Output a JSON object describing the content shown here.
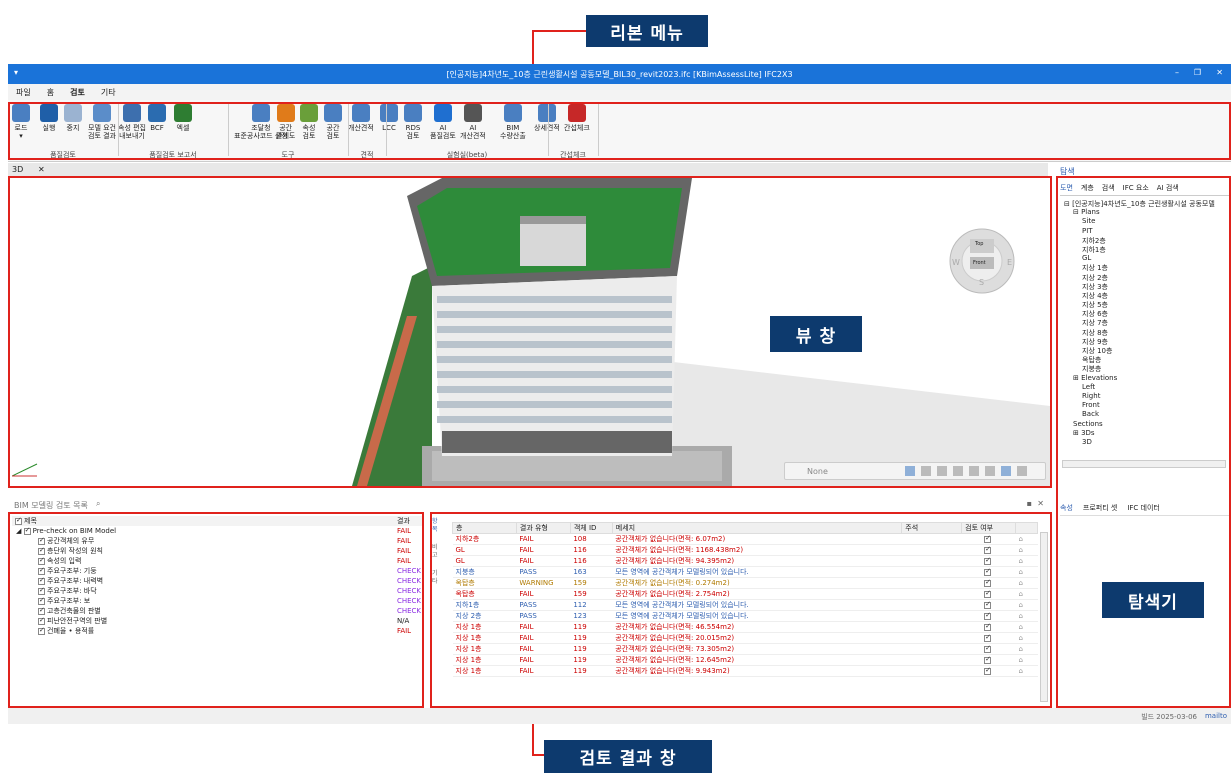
{
  "callouts": {
    "ribbon": "리본 메뉴",
    "view": "뷰 창",
    "navigator": "탐색기",
    "results": "검토 결과 창"
  },
  "window": {
    "title": "[인공지능]4차년도_10층 근린생활시설 공동모델_BIL30_revit2023.ifc [KBimAssessLite] IFC2X3",
    "minimize": "–",
    "restore": "❐",
    "close": "✕",
    "quick_access": "▾"
  },
  "menu": [
    "파일",
    "홈",
    "검토",
    "기타"
  ],
  "ribbon": {
    "buttons": [
      {
        "label": "로드\n▾",
        "icon": "load-icon",
        "color": "#4a7fc1"
      },
      {
        "label": "실행",
        "icon": "play-icon",
        "color": "#1f5fa8"
      },
      {
        "label": "중지",
        "icon": "stop-icon",
        "color": "#9bb3d1"
      },
      {
        "label": "모델 요건\n검토 결과",
        "icon": "report-icon",
        "color": "#5b8dc9"
      },
      {
        "label": "속성 편집\n내보내기",
        "icon": "export-icon",
        "color": "#3d6fae"
      },
      {
        "label": "BCF",
        "icon": "bcf-icon",
        "color": "#2b6cb0"
      },
      {
        "label": "엑셀",
        "icon": "excel-icon",
        "color": "#2e7d32"
      },
      {
        "label": "조달청\n표준공사코드 설정",
        "icon": "code-icon",
        "color": "#4a7fc1"
      },
      {
        "label": "공간\n관계도",
        "icon": "relation-icon",
        "color": "#e07b1a"
      },
      {
        "label": "속성\n검토",
        "icon": "property-icon",
        "color": "#6a9f3a"
      },
      {
        "label": "공간\n검토",
        "icon": "space-icon",
        "color": "#4a7fc1"
      },
      {
        "label": "개산견적",
        "icon": "estimate-icon",
        "color": "#4a7fc1"
      },
      {
        "label": "LCC",
        "icon": "lcc-icon",
        "color": "#4a7fc1"
      },
      {
        "label": "RDS\n검토",
        "icon": "rds-icon",
        "color": "#4a7fc1"
      },
      {
        "label": "AI\n품질검토",
        "icon": "ai-icon",
        "color": "#1f6fd0"
      },
      {
        "label": "AI\n개산견적",
        "icon": "ai-brain-icon",
        "color": "#555"
      },
      {
        "label": "BIM\n수량산출",
        "icon": "calculator-icon",
        "color": "#4a7fc1"
      },
      {
        "label": "상세견적",
        "icon": "detail-icon",
        "color": "#4a7fc1"
      },
      {
        "label": "간섭체크",
        "icon": "clash-icon",
        "color": "#c62828"
      }
    ],
    "groups": [
      "품질검토",
      "품질검토 보고서",
      "도구",
      "견적",
      "실험실(beta)",
      "간섭체크"
    ]
  },
  "view": {
    "tab": "3D",
    "tab_close": "✕",
    "compass": {
      "top": "Top",
      "front": "Front",
      "w": "W",
      "e": "E",
      "s": "S"
    },
    "toolbar_select": "None"
  },
  "results": {
    "header": "BIM 모델링 검토 목록",
    "tree_headers": {
      "name": "제목",
      "result": "결과"
    },
    "tree": [
      {
        "name": "Pre-check on BIM Model",
        "result": "FAIL",
        "cls": "fail",
        "level": 0
      },
      {
        "name": "공간객체의 유무",
        "result": "FAIL",
        "cls": "fail",
        "level": 1
      },
      {
        "name": "층단위 작성의 원칙",
        "result": "FAIL",
        "cls": "fail",
        "level": 1
      },
      {
        "name": "속성의 입력",
        "result": "FAIL",
        "cls": "fail",
        "level": 1
      },
      {
        "name": "주요구조부: 기둥",
        "result": "CHECK",
        "cls": "check",
        "level": 1
      },
      {
        "name": "주요구조부: 내력벽",
        "result": "CHECK",
        "cls": "check",
        "level": 1
      },
      {
        "name": "주요구조부: 바닥",
        "result": "CHECK",
        "cls": "check",
        "level": 1
      },
      {
        "name": "주요구조부: 보",
        "result": "CHECK",
        "cls": "check",
        "level": 1
      },
      {
        "name": "고층건축물의 판별",
        "result": "CHECK",
        "cls": "check",
        "level": 1
      },
      {
        "name": "피난안전구역의 판별",
        "result": "N/A",
        "cls": "",
        "level": 1
      },
      {
        "name": "건폐율 • 용적률",
        "result": "FAIL",
        "cls": "fail",
        "level": 1
      }
    ],
    "side_tabs": [
      "항목",
      "비고",
      "기타"
    ],
    "detail_headers": {
      "floor": "층",
      "type": "결과 유형",
      "id": "객체 ID",
      "message": "메세지",
      "note": "주석",
      "review": "검토 여부"
    },
    "details": [
      {
        "floor": "지하2층",
        "type": "FAIL",
        "id": "108",
        "message": "공간객체가 없습니다(면적: 6.07m2)",
        "cls": "fail"
      },
      {
        "floor": "GL",
        "type": "FAIL",
        "id": "116",
        "message": "공간객체가 없습니다(면적: 1168.438m2)",
        "cls": "fail"
      },
      {
        "floor": "GL",
        "type": "FAIL",
        "id": "116",
        "message": "공간객체가 없습니다(면적: 94.395m2)",
        "cls": "fail"
      },
      {
        "floor": "지붕층",
        "type": "PASS",
        "id": "163",
        "message": "모든 영역에 공간객체가 모델링되어 있습니다.",
        "cls": "pass"
      },
      {
        "floor": "옥탑층",
        "type": "WARNING",
        "id": "159",
        "message": "공간객체가 없습니다(면적: 0.274m2)",
        "cls": "warn"
      },
      {
        "floor": "옥탑층",
        "type": "FAIL",
        "id": "159",
        "message": "공간객체가 없습니다(면적: 2.754m2)",
        "cls": "fail"
      },
      {
        "floor": "지하1층",
        "type": "PASS",
        "id": "112",
        "message": "모든 영역에 공간객체가 모델링되어 있습니다.",
        "cls": "pass"
      },
      {
        "floor": "지상 2층",
        "type": "PASS",
        "id": "123",
        "message": "모든 영역에 공간객체가 모델링되어 있습니다.",
        "cls": "pass"
      },
      {
        "floor": "지상 1층",
        "type": "FAIL",
        "id": "119",
        "message": "공간객체가 없습니다(면적: 46.554m2)",
        "cls": "fail"
      },
      {
        "floor": "지상 1층",
        "type": "FAIL",
        "id": "119",
        "message": "공간객체가 없습니다(면적: 20.015m2)",
        "cls": "fail"
      },
      {
        "floor": "지상 1층",
        "type": "FAIL",
        "id": "119",
        "message": "공간객체가 없습니다(면적: 73.305m2)",
        "cls": "fail"
      },
      {
        "floor": "지상 1층",
        "type": "FAIL",
        "id": "119",
        "message": "공간객체가 없습니다(면적: 12.645m2)",
        "cls": "fail"
      },
      {
        "floor": "지상 1층",
        "type": "FAIL",
        "id": "119",
        "message": "공간객체가 없습니다(면적: 9.943m2)",
        "cls": "fail"
      }
    ]
  },
  "navigator": {
    "header": "탐색",
    "tabs": [
      "도면",
      "계층",
      "검색",
      "IFC 요소",
      "AI 검색"
    ],
    "tree": [
      "⊟ [인공지능]4차년도_10층 근린생활시설 공동모델",
      "⊟ Plans",
      "Site",
      "PIT",
      "지하2층",
      "지하1층",
      "GL",
      "지상 1층",
      "지상 2층",
      "지상 3층",
      "지상 4층",
      "지상 5층",
      "지상 6층",
      "지상 7층",
      "지상 8층",
      "지상 9층",
      "지상 10층",
      "옥탑층",
      "지붕층",
      "⊞ Elevations",
      "Left",
      "Right",
      "Front",
      "Back",
      "Sections",
      "⊞ 3Ds",
      "3D"
    ],
    "tree_levels": [
      0,
      1,
      2,
      2,
      2,
      2,
      2,
      2,
      2,
      2,
      2,
      2,
      2,
      2,
      2,
      2,
      2,
      2,
      2,
      1,
      2,
      2,
      2,
      2,
      1,
      1,
      2
    ],
    "bottom_tabs": [
      "속성",
      "프로퍼티 셋",
      "IFC 데이터"
    ]
  },
  "status": {
    "build": "빌드 2025-03-06",
    "link": "mailto"
  }
}
